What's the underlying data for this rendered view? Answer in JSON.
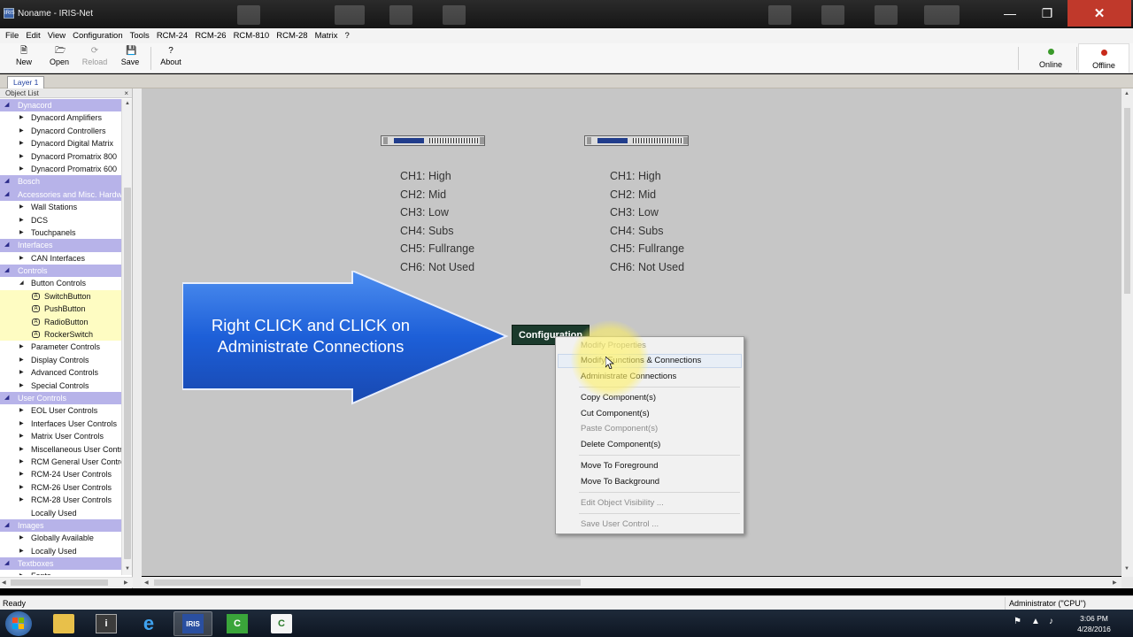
{
  "window": {
    "title": "Noname - IRIS-Net",
    "app_icon": "IRIS"
  },
  "menu": [
    "File",
    "Edit",
    "View",
    "Configuration",
    "Tools",
    "RCM-24",
    "RCM-26",
    "RCM-810",
    "RCM-28",
    "Matrix",
    "?"
  ],
  "toolbar": {
    "new": "New",
    "open": "Open",
    "reload": "Reload",
    "save": "Save",
    "about": "About",
    "online": "Online",
    "offline": "Offline",
    "online_color": "#3a9a2a",
    "offline_color": "#c82a1a"
  },
  "layer_tab": "Layer 1",
  "object_list": {
    "title": "Object List",
    "close": "×",
    "rows": [
      {
        "type": "cat",
        "label": "Dynacord"
      },
      {
        "type": "sub",
        "label": "Dynacord Amplifiers"
      },
      {
        "type": "sub",
        "label": "Dynacord Controllers"
      },
      {
        "type": "sub",
        "label": "Dynacord Digital Matrix"
      },
      {
        "type": "sub",
        "label": "Dynacord Promatrix 800"
      },
      {
        "type": "sub",
        "label": "Dynacord Promatrix 600"
      },
      {
        "type": "cat",
        "label": "Bosch"
      },
      {
        "type": "cat",
        "label": "Accessories and Misc. Hardware"
      },
      {
        "type": "sub",
        "label": "Wall Stations"
      },
      {
        "type": "sub",
        "label": "DCS"
      },
      {
        "type": "sub",
        "label": "Touchpanels"
      },
      {
        "type": "cat",
        "label": "Interfaces"
      },
      {
        "type": "sub",
        "label": "CAN Interfaces"
      },
      {
        "type": "cat",
        "label": "Controls"
      },
      {
        "type": "subopen",
        "label": "Button Controls"
      },
      {
        "type": "leaf",
        "label": "SwitchButton"
      },
      {
        "type": "leaf",
        "label": "PushButton"
      },
      {
        "type": "leaf",
        "label": "RadioButton"
      },
      {
        "type": "leaf",
        "label": "RockerSwitch"
      },
      {
        "type": "sub",
        "label": "Parameter Controls"
      },
      {
        "type": "sub",
        "label": "Display Controls"
      },
      {
        "type": "sub",
        "label": "Advanced Controls"
      },
      {
        "type": "sub",
        "label": "Special Controls"
      },
      {
        "type": "cat",
        "label": "User Controls"
      },
      {
        "type": "sub",
        "label": "EOL User Controls"
      },
      {
        "type": "sub",
        "label": "Interfaces User Controls"
      },
      {
        "type": "sub",
        "label": "Matrix User Controls"
      },
      {
        "type": "sub",
        "label": "Miscellaneous User Controls"
      },
      {
        "type": "sub",
        "label": "RCM General User Controls"
      },
      {
        "type": "sub",
        "label": "RCM-24 User Controls"
      },
      {
        "type": "sub",
        "label": "RCM-26 User Controls"
      },
      {
        "type": "sub",
        "label": "RCM-28 User Controls"
      },
      {
        "type": "plain",
        "label": "Locally Used"
      },
      {
        "type": "cat",
        "label": "Images"
      },
      {
        "type": "sub",
        "label": "Globally Available"
      },
      {
        "type": "sub",
        "label": "Locally Used"
      },
      {
        "type": "cat",
        "label": "Textboxes"
      },
      {
        "type": "sub",
        "label": "Fonts"
      }
    ]
  },
  "channels_left": [
    "CH1: High",
    "CH2: Mid",
    "CH3: Low",
    "CH4: Subs",
    "CH5: Fullrange",
    "CH6: Not Used"
  ],
  "channels_right": [
    "CH1: High",
    "CH2: Mid",
    "CH3: Low",
    "CH4: Subs",
    "CH5: Fullrange",
    "CH6: Not Used"
  ],
  "callout": {
    "line1": "Right CLICK and CLICK on",
    "line2": "Administrate Connections"
  },
  "config_box": "Configuration",
  "context_menu": {
    "modify_properties": "Modify Properties",
    "modify_functions": "Modify Functions & Connections",
    "administrate": "Administrate Connections",
    "copy": "Copy Component(s)",
    "cut": "Cut Component(s)",
    "paste": "Paste Component(s)",
    "delete": "Delete Component(s)",
    "foreground": "Move To Foreground",
    "background": "Move To Background",
    "visibility": "Edit Object Visibility ...",
    "save_user_control": "Save User Control ..."
  },
  "status": {
    "left": "Ready",
    "right": "Administrator (\"CPU\")"
  },
  "taskbar": {
    "time": "3:06 PM",
    "date": "4/28/2016"
  }
}
